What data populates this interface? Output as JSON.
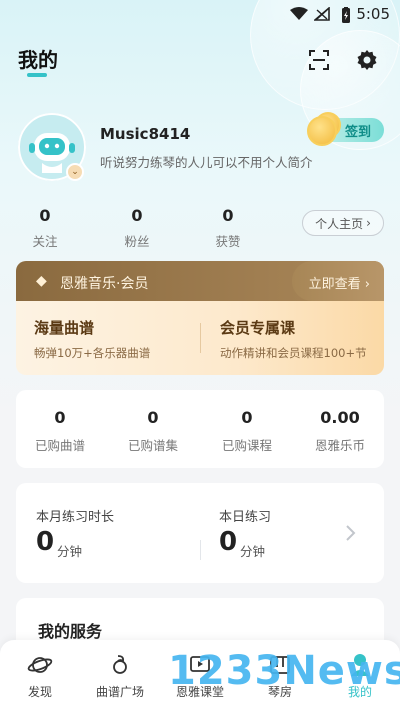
{
  "status_bar": {
    "time": "5:05"
  },
  "header": {
    "title": "我的"
  },
  "profile": {
    "username": "Music8414",
    "bio": "听说努力练琴的人儿可以不用个人简介",
    "signin_label": "签到"
  },
  "stats": [
    {
      "value": "0",
      "label": "关注"
    },
    {
      "value": "0",
      "label": "粉丝"
    },
    {
      "value": "0",
      "label": "获赞"
    }
  ],
  "homepage_button": "个人主页",
  "vip": {
    "title": "恩雅音乐·会员",
    "view_label": "立即查看",
    "items": [
      {
        "title": "海量曲谱",
        "subtitle": "畅弹10万+各乐器曲谱"
      },
      {
        "title": "会员专属课",
        "subtitle": "动作精讲和会员课程100+节"
      }
    ]
  },
  "purchases": [
    {
      "value": "0",
      "label": "已购曲谱"
    },
    {
      "value": "0",
      "label": "已购谱集"
    },
    {
      "value": "0",
      "label": "已购课程"
    },
    {
      "value": "0.00",
      "label": "恩雅乐币"
    }
  ],
  "practice": {
    "month_label": "本月练习时长",
    "month_value": "0",
    "month_unit": "分钟",
    "day_label": "本日练习",
    "day_value": "0",
    "day_unit": "分钟"
  },
  "services_title": "我的服务",
  "nav": [
    {
      "label": "发现",
      "icon": "planet-icon"
    },
    {
      "label": "曲谱广场",
      "icon": "music-note-icon"
    },
    {
      "label": "恩雅课堂",
      "icon": "classroom-icon"
    },
    {
      "label": "琴房",
      "icon": "piano-room-icon"
    },
    {
      "label": "我的",
      "icon": "user-icon",
      "active": true
    }
  ],
  "watermark": "1233News",
  "colors": {
    "accent": "#35c2c8",
    "vip_dark": "#8a6a3f",
    "vip_light": "#fde9cc"
  }
}
